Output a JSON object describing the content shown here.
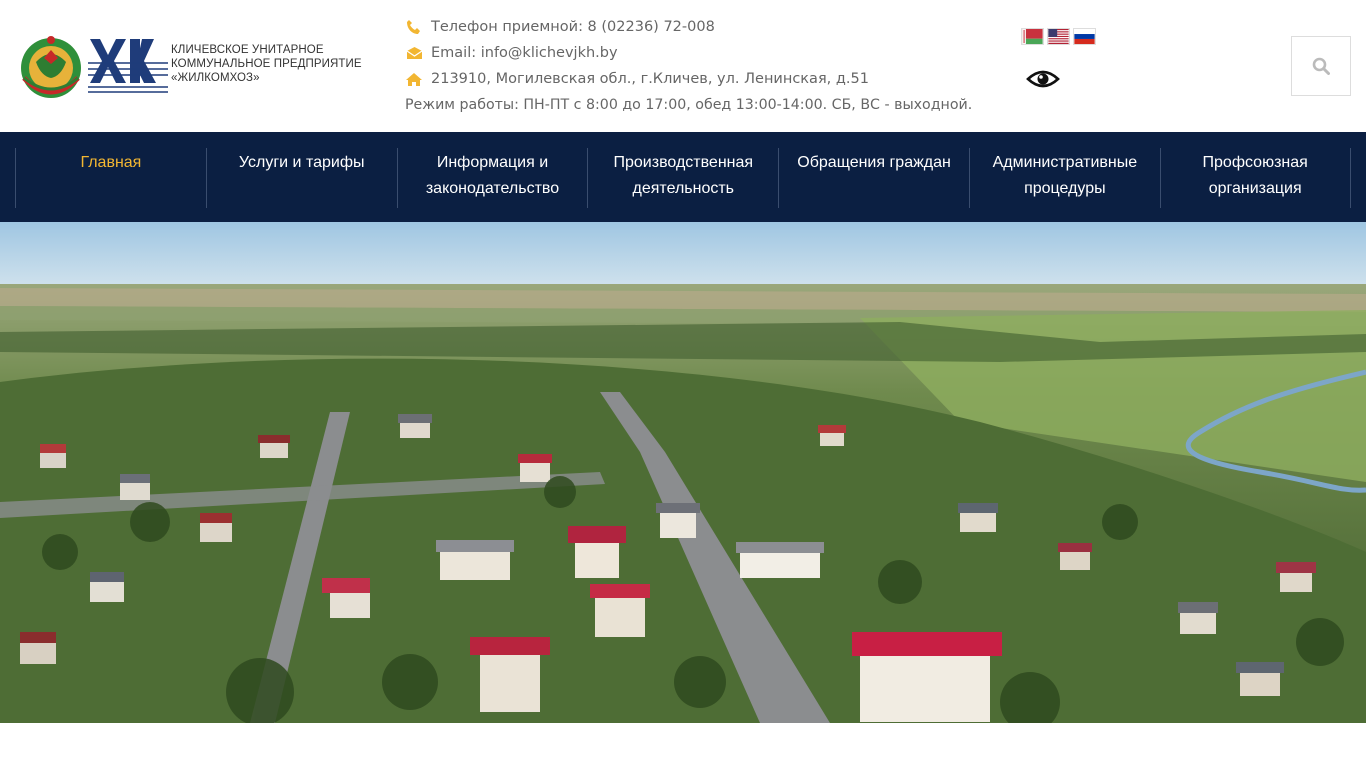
{
  "header": {
    "logo_text": [
      "КЛИЧЕВСКОЕ УНИТАРНОЕ",
      "КОММУНАЛЬНОЕ ПРЕДПРИЯТИЕ",
      "«ЖИЛКОМХОЗ»"
    ],
    "phone": "Телефон приемной: 8 (02236) 72-008",
    "email": "Email: info@klichevjkh.by",
    "address": "213910, Могилевская обл., г.Кличев, ул. Ленинская, д.51",
    "hours": "Режим работы: ПН-ПТ с 8:00 до 17:00, обед 13:00-14:00. СБ, ВС - выходной."
  },
  "languages": [
    "by",
    "en",
    "ru"
  ],
  "icons": {
    "phone": "phone-icon",
    "email": "envelope-icon",
    "address": "home-icon",
    "accessibility": "eye-icon",
    "search": "search-icon"
  },
  "nav": {
    "items": [
      {
        "line1": "Главная",
        "line2": ""
      },
      {
        "line1": "Услуги и тарифы",
        "line2": ""
      },
      {
        "line1": "Информация и",
        "line2": "законодательство"
      },
      {
        "line1": "Производственная",
        "line2": "деятельность"
      },
      {
        "line1": "Обращения граждан",
        "line2": ""
      },
      {
        "line1": "Административные",
        "line2": "процедуры"
      },
      {
        "line1": "Профсоюзная",
        "line2": "организация"
      }
    ]
  },
  "colors": {
    "accent": "#f2b632",
    "nav_bg": "#0b1f42",
    "nav_text": "#ffffff"
  }
}
